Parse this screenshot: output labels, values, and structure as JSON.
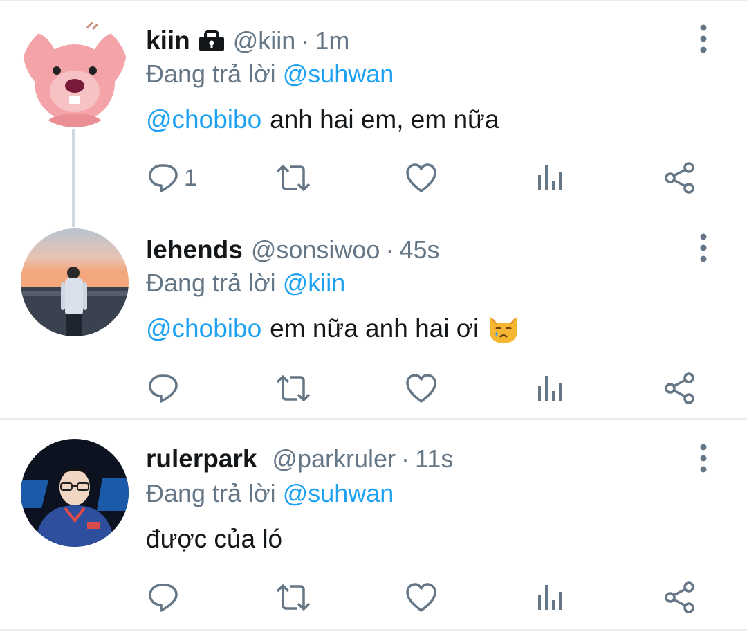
{
  "tweets": [
    {
      "name": "kiin",
      "handle": "@kiin",
      "separator": "·",
      "time": "1m",
      "replying_prefix": "Đang trả lời",
      "replying_to": "@suhwan",
      "mention": "@chobibo",
      "text": "anh hai em, em nữa",
      "reply_count": "1",
      "avatar": "pink-beaver-avatar",
      "protected": true
    },
    {
      "name": "lehends",
      "handle": "@sonsiwoo",
      "separator": "·",
      "time": "45s",
      "replying_prefix": "Đang trả lời",
      "replying_to": "@kiin",
      "mention": "@chobibo",
      "text": "em nữa anh hai ơi",
      "emoji": "crying-cat-face",
      "reply_count": "",
      "avatar": "sunset-person-avatar"
    },
    {
      "name": "rulerpark",
      "handle": "@parkruler",
      "separator": "·",
      "time": "11s",
      "replying_prefix": "Đang trả lời",
      "replying_to": "@suhwan",
      "text": "được của ló",
      "reply_count": "",
      "avatar": "player-photo-avatar"
    }
  ],
  "icons": [
    "reply-icon",
    "retweet-icon",
    "like-icon",
    "analytics-icon",
    "share-icon",
    "more-icon",
    "lock-icon"
  ],
  "colors": {
    "link": "#1da1f2",
    "secondary_text": "#657786",
    "primary_text": "#14171a",
    "thread_line": "#cfd9de",
    "divider": "#e6ecf0"
  }
}
